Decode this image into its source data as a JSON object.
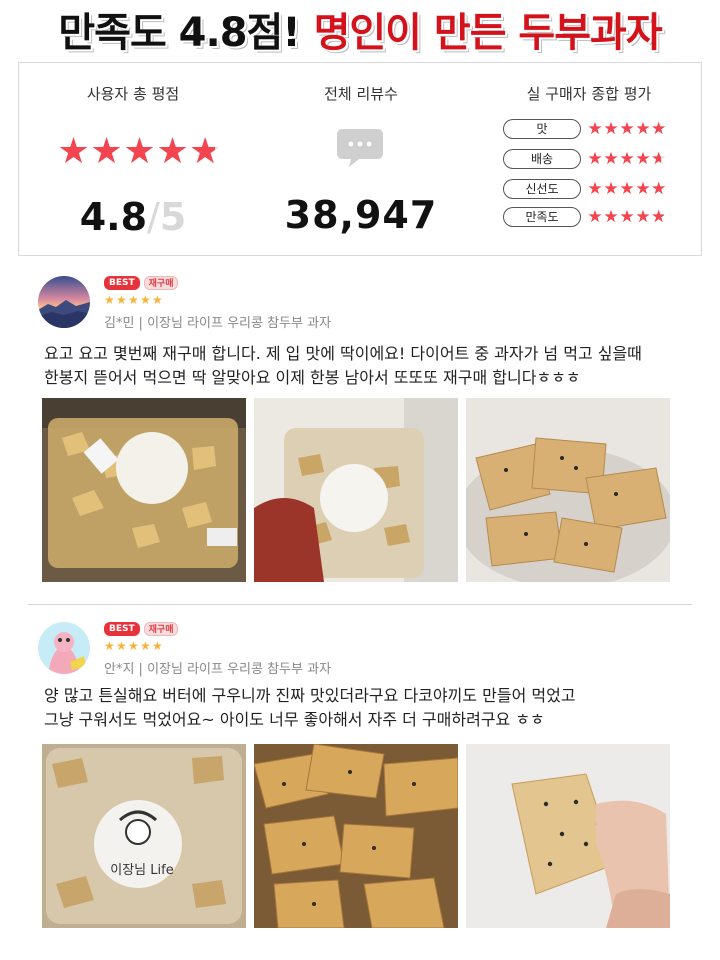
{
  "headline": {
    "black_text": "만족도 4.8점!",
    "red_text": "명인이 만든 두부과자",
    "black_color": "#111111",
    "red_color": "#d3121b"
  },
  "summary": {
    "average": {
      "title": "사용자 총 평점",
      "score": "4.8",
      "separator": "/",
      "max": "5",
      "star_fill": 4.8
    },
    "total_reviews": {
      "title": "전체 리뷰수",
      "count": "38,947",
      "icon": "speech-bubble-icon"
    },
    "buyer_eval": {
      "title": "실 구매자 종합 평가",
      "rows": [
        {
          "label": "맛",
          "rating": 4.9
        },
        {
          "label": "배송",
          "rating": 4.6
        },
        {
          "label": "신선도",
          "rating": 4.9
        },
        {
          "label": "만족도",
          "rating": 4.8
        }
      ]
    },
    "accent_color": "#f2454f"
  },
  "reviews": [
    {
      "badges": [
        "BEST",
        "재구매"
      ],
      "stars": 5,
      "meta": "김*민 | 이장님 라이프 우리콩 참두부 과자",
      "text_lines": [
        "요고 요고 몇번째 재구매 합니다. 제 입 맛에 딱이에요! 다이어트 중 과자가 넘 먹고 싶을때",
        "한봉지 뜯어서 먹으면 딱 알맞아요 이제 한봉 남아서 또또또 재구매 합니다ㅎㅎㅎ"
      ]
    },
    {
      "badges": [
        "BEST",
        "재구매"
      ],
      "stars": 5,
      "meta": "안*지 | 이장님 라이프 우리콩 참두부 과자",
      "text_lines": [
        "양 많고 튼실해요 버터에 구우니까 진짜 맛있더라구요 다코야끼도 만들어 먹었고",
        "그냥 구워서도 먹었어요~ 아이도 너무 좋아해서 자주 더 구매하려구요 ㅎㅎ"
      ]
    }
  ],
  "package_label": "이장님 Life"
}
